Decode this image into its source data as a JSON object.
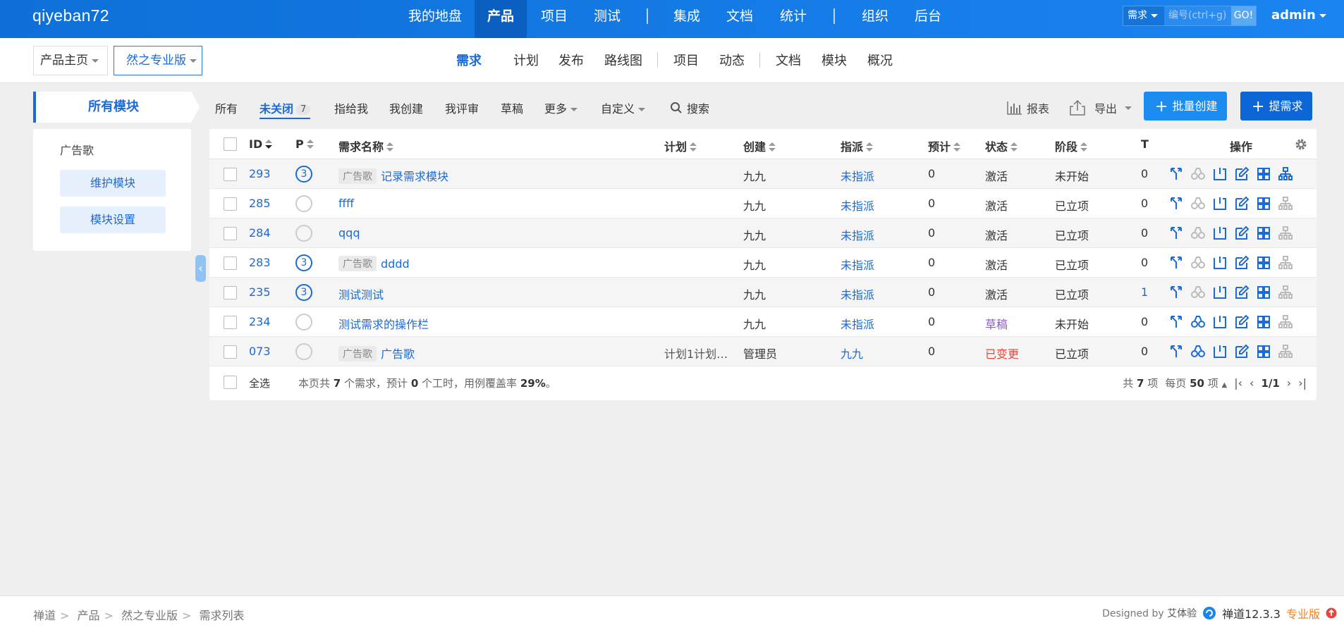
{
  "header": {
    "brand": "qiyeban72",
    "nav": [
      "我的地盘",
      "产品",
      "项目",
      "测试",
      "集成",
      "文档",
      "统计",
      "组织",
      "后台"
    ],
    "active_nav": "产品",
    "search_type": "需求",
    "search_placeholder": "编号(ctrl+g)",
    "go_label": "GO!",
    "user": "admin"
  },
  "subbar": {
    "crumb_home": "产品主页",
    "crumb_product": "然之专业版",
    "nav": [
      "需求",
      "计划",
      "发布",
      "路线图",
      "项目",
      "动态",
      "文档",
      "模块",
      "概况"
    ],
    "active": "需求"
  },
  "modules": {
    "title": "所有模块",
    "name": "广告歌",
    "maintain": "维护模块",
    "settings": "模块设置"
  },
  "filters": {
    "all": "所有",
    "unclosed": "未关闭",
    "unclosed_count": "7",
    "assigned": "指给我",
    "created": "我创建",
    "reviewing": "我评审",
    "draft": "草稿",
    "more": "更多",
    "custom": "自定义",
    "search": "搜索",
    "report": "报表",
    "export": "导出",
    "batch_create": "批量创建",
    "create": "提需求"
  },
  "table": {
    "headers": {
      "id": "ID",
      "p": "P",
      "name": "需求名称",
      "plan": "计划",
      "creator": "创建",
      "assign": "指派",
      "estimate": "预计",
      "status": "状态",
      "stage": "阶段",
      "t": "T",
      "ops": "操作"
    },
    "rows": [
      {
        "id": "293",
        "pri": "3",
        "tag": "广告歌",
        "name": "记录需求模块",
        "plan": "",
        "creator": "九九",
        "assign": "未指派",
        "estimate": "0",
        "status": "激活",
        "status_type": "active",
        "stage": "未开始",
        "t": "0"
      },
      {
        "id": "285",
        "pri": "",
        "tag": "",
        "name": "ffff",
        "plan": "",
        "creator": "九九",
        "assign": "未指派",
        "estimate": "0",
        "status": "激活",
        "status_type": "active",
        "stage": "已立项",
        "t": "0"
      },
      {
        "id": "284",
        "pri": "",
        "tag": "",
        "name": "qqq",
        "plan": "",
        "creator": "九九",
        "assign": "未指派",
        "estimate": "0",
        "status": "激活",
        "status_type": "active",
        "stage": "已立项",
        "t": "0"
      },
      {
        "id": "283",
        "pri": "3",
        "tag": "广告歌",
        "name": "dddd",
        "plan": "",
        "creator": "九九",
        "assign": "未指派",
        "estimate": "0",
        "status": "激活",
        "status_type": "active",
        "stage": "已立项",
        "t": "0"
      },
      {
        "id": "235",
        "pri": "3",
        "tag": "",
        "name": "测试测试",
        "plan": "",
        "creator": "九九",
        "assign": "未指派",
        "estimate": "0",
        "status": "激活",
        "status_type": "active",
        "stage": "已立项",
        "t": "1"
      },
      {
        "id": "234",
        "pri": "",
        "tag": "",
        "name": "测试需求的操作栏",
        "plan": "",
        "creator": "九九",
        "assign": "未指派",
        "estimate": "0",
        "status": "草稿",
        "status_type": "draft",
        "stage": "未开始",
        "t": "0"
      },
      {
        "id": "073",
        "pri": "",
        "tag": "广告歌",
        "name": "广告歌",
        "plan": "计划1计划…",
        "creator": "管理员",
        "assign": "九九",
        "estimate": "0",
        "status": "已变更",
        "status_type": "changed",
        "stage": "已立项",
        "t": "0"
      }
    ],
    "select_all": "全选",
    "summary_a": "本页共",
    "summary_count": "7",
    "summary_b": "个需求，预计",
    "summary_hours": "0",
    "summary_c": "个工时，用例覆盖率",
    "summary_rate": "29%",
    "summary_d": "。",
    "total_a": "共",
    "total_count": "7",
    "total_b": "项",
    "per_a": "每页",
    "per_count": "50",
    "per_b": "项",
    "page": "1/1"
  },
  "footer": {
    "breadcrumb": [
      "禅道",
      "产品",
      "然之专业版",
      "需求列表"
    ],
    "designed_by": "Designed by",
    "designer": "艾体验",
    "version": "禅道12.3.3",
    "edition": "专业版"
  },
  "colors": {
    "primary": "#1a6ad8",
    "header": "#1a84f0",
    "draft": "#8b5cc7",
    "changed": "#e8463c"
  }
}
